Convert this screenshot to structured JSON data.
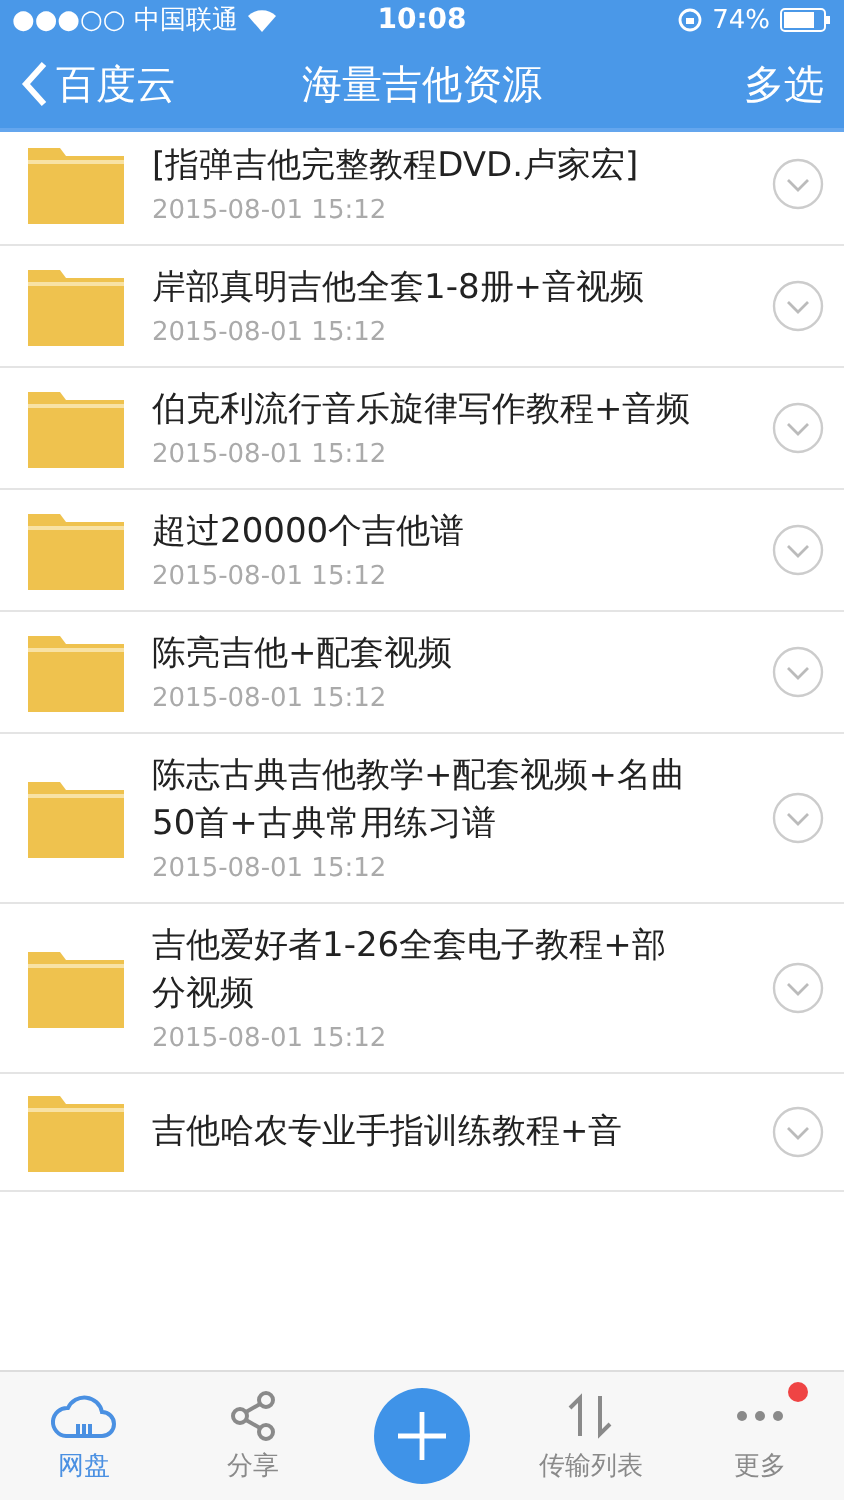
{
  "status_bar": {
    "signal_carrier": "●●●○○ 中国联通",
    "time": "10:08",
    "battery": "74%"
  },
  "nav_bar": {
    "back": "百度云",
    "title": "海量吉他资源",
    "action": "多选"
  },
  "files": [
    {
      "name": "[指弹吉他完整教程DVD.卢家宏]",
      "date": "2015-08-01 15:12"
    },
    {
      "name": "岸部真明吉他全套1-8册+音视频",
      "date": "2015-08-01 15:12"
    },
    {
      "name": "伯克利流行音乐旋律写作教程+音频",
      "date": "2015-08-01 15:12"
    },
    {
      "name": "超过20000个吉他谱",
      "date": "2015-08-01 15:12"
    },
    {
      "name": "陈亮吉他+配套视频",
      "date": "2015-08-01 15:12"
    },
    {
      "name": "陈志古典吉他教学+配套视频+名曲50首+古典常用练习谱",
      "date": "2015-08-01 15:12"
    },
    {
      "name": "吉他爱好者1-26全套电子教程+部分视频",
      "date": "2015-08-01 15:12"
    },
    {
      "name": "吉他哈农专业手指训练教程+音"
    }
  ],
  "tab_bar": [
    {
      "kind": "tab",
      "label": "网盘",
      "selected": true,
      "badge": false
    },
    {
      "kind": "tab",
      "label": "分享",
      "selected": false,
      "badge": false
    },
    {
      "kind": "add"
    },
    {
      "kind": "tab",
      "label": "传输列表",
      "selected": false,
      "badge": false
    },
    {
      "kind": "tab",
      "label": "更多",
      "selected": false,
      "badge": true
    }
  ]
}
